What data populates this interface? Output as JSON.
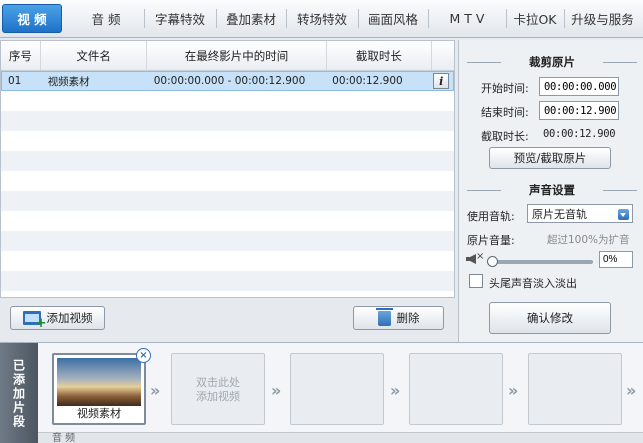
{
  "tabs": [
    {
      "label": "视 频",
      "active": true
    },
    {
      "label": "音 频"
    },
    {
      "label": "字幕特效"
    },
    {
      "label": "叠加素材"
    },
    {
      "label": "转场特效"
    },
    {
      "label": "画面风格"
    },
    {
      "label": "M T V"
    },
    {
      "label": "卡拉OK"
    },
    {
      "label": "升级与服务"
    }
  ],
  "table": {
    "headers": [
      "序号",
      "文件名",
      "在最终影片中的时间",
      "截取时长"
    ],
    "rows": [
      {
        "index": "01",
        "filename": "视频素材",
        "timeline": "00:00:00.000 - 00:00:12.900",
        "duration": "00:00:12.900",
        "info": "i"
      }
    ]
  },
  "actions": {
    "add_video": "添加视频",
    "delete": "删除"
  },
  "trim": {
    "title": "裁剪原片",
    "start_label": "开始时间:",
    "start_value": "00:00:00.000",
    "end_label": "结束时间:",
    "end_value": "00:00:12.900",
    "duration_label": "截取时长:",
    "duration_value": "00:00:12.900",
    "preview_button": "预览/截取原片"
  },
  "audio": {
    "title": "声音设置",
    "track_label": "使用音轨:",
    "track_value": "原片无音轨",
    "volume_label": "原片音量:",
    "volume_hint": "超过100%为扩音",
    "volume_value": "0%",
    "volume_level": 0,
    "mute_mark": "×",
    "fade_label": "头尾声音淡入淡出",
    "confirm_button": "确认修改"
  },
  "strip": {
    "label": "已添加片段",
    "clip_name": "视频素材",
    "close_mark": "×",
    "empty_hint_line1": "双击此处",
    "empty_hint_line2": "添加视频",
    "chevron": "»",
    "audio_label": "音 频"
  }
}
